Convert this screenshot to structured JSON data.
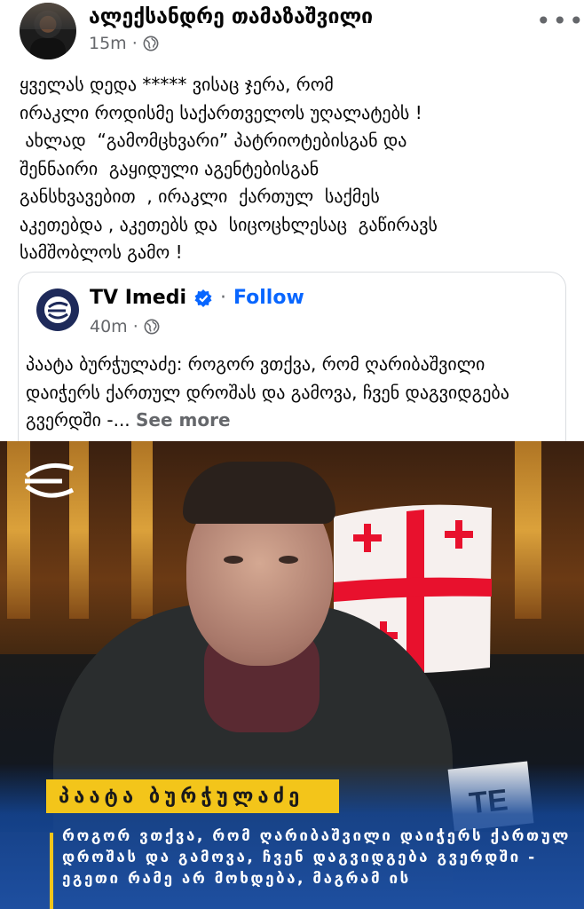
{
  "post": {
    "author": "ალექსანდრე თამაზაშვილი",
    "time": "15m",
    "separator": "·",
    "more_label": "•••",
    "text": "ყველას დედა ***** ვისაც ჯერა, რომ\nირაკლი როდისმე საქართველოს უღალატებს !\n ახლად  “გამომცხვარი” პატრიოტებისგან და\nშენნაირი  გაყიდული აგენტებისგან\nგანსხვავებით  , ირაკლი  ქართულ  საქმეს\nაკეთებდა , აკეთებს და  სიცოცხლესაც  გაწირავს\nსამშობლოს გამო !"
  },
  "shared": {
    "page_name": "TV Imedi",
    "separator": "·",
    "follow_label": "Follow",
    "time": "40m",
    "text": "პაატა ბურჭულაძე: როგორ ვთქვა, რომ ღარიბაშვილი დაიჭერს ქართულ დროშას და გამოვა, ჩვენ დაგვიდგება გვერდში -...",
    "see_more_label": "See more"
  },
  "media": {
    "name_bar": "პაატა ბურჭულაძე",
    "quote": "როგორ ვთქვა, რომ ღარიბაშვილი დაიჭერს ქართულ დროშას და გამოვა, ჩვენ დაგვიდგება გვერდში - ეგეთი რამე არ მოხდება, მაგრამ ის",
    "sign_text": "TE"
  },
  "colors": {
    "link_blue": "#0866ff",
    "secondary_text": "#65676b",
    "name_bar_yellow": "#f3c51a",
    "flag_red": "#e8112d"
  },
  "icons": {
    "privacy": "globe-icon",
    "verified": "verified-badge-icon",
    "more": "more-options-icon"
  }
}
